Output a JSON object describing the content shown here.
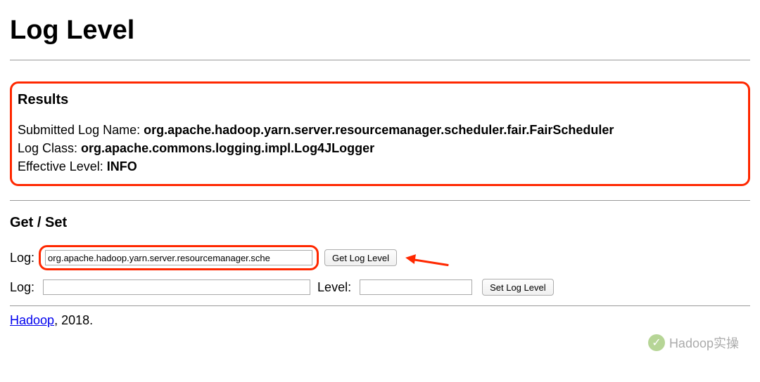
{
  "pageTitle": "Log Level",
  "results": {
    "heading": "Results",
    "submittedLogNameLabel": "Submitted Log Name: ",
    "submittedLogNameValue": "org.apache.hadoop.yarn.server.resourcemanager.scheduler.fair.FairScheduler",
    "logClassLabel": "Log Class: ",
    "logClassValue": "org.apache.commons.logging.impl.Log4JLogger",
    "effectiveLevelLabel": "Effective Level: ",
    "effectiveLevelValue": "INFO"
  },
  "getSet": {
    "heading": "Get / Set",
    "logLabel": "Log:",
    "levelLabel": "Level:",
    "getLogInputValue": "org.apache.hadoop.yarn.server.resourcemanager.sche",
    "setLogInputValue": "",
    "levelInputValue": "",
    "getButtonLabel": "Get Log Level",
    "setButtonLabel": "Set Log Level"
  },
  "footer": {
    "linkText": "Hadoop",
    "yearSuffix": ", 2018."
  },
  "watermark": {
    "text": "Hadoop实操"
  }
}
